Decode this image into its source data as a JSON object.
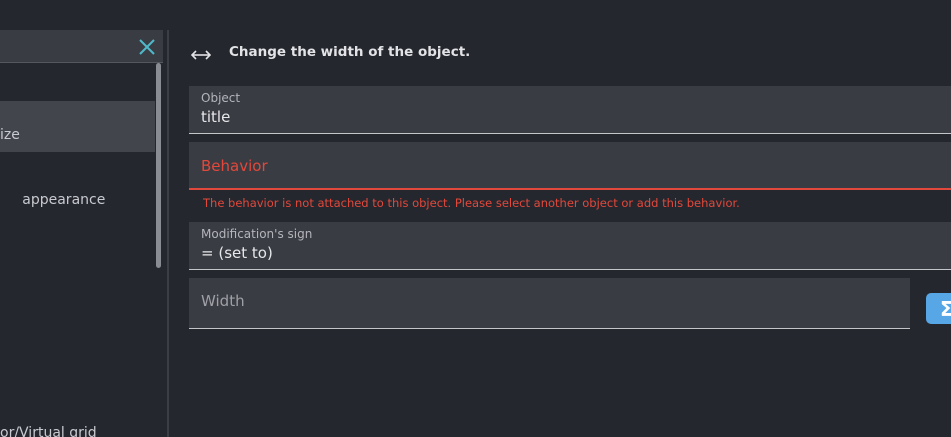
{
  "sidebar": {
    "items": [
      {
        "label": "ize"
      },
      {
        "label": " appearance"
      },
      {
        "label": "or/Virtual grid"
      }
    ]
  },
  "instruction": {
    "icon": "horizontal-resize-icon",
    "description": "Change the width of the object."
  },
  "fields": {
    "object": {
      "label": "Object",
      "value": "title"
    },
    "behavior": {
      "placeholder": "Behavior",
      "error": "The behavior is not attached to this object. Please select another object or add this behavior."
    },
    "modification_sign": {
      "label": "Modification's sign",
      "value": "= (set to)"
    },
    "width": {
      "placeholder": "Width"
    }
  },
  "expression_button": {
    "symbol": "Σ"
  },
  "colors": {
    "background": "#25272e",
    "field_background": "#3a3c43",
    "error": "#e2483b",
    "accent": "#57a6e6",
    "clear_icon": "#4fb8c9"
  }
}
